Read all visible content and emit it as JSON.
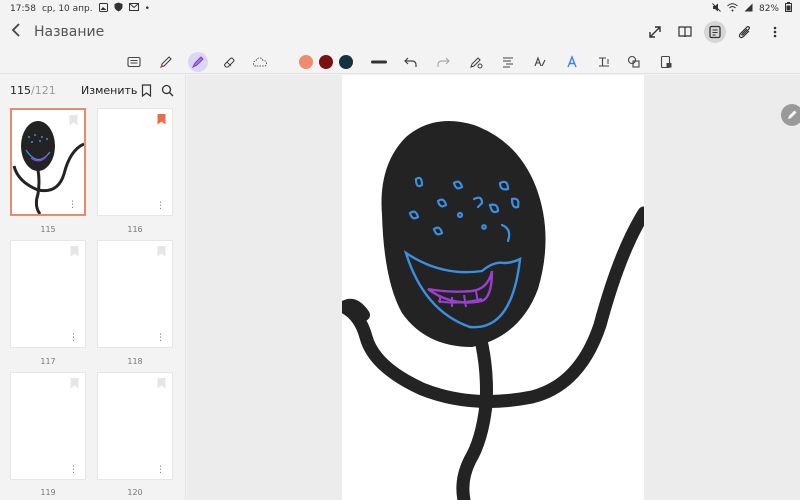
{
  "status_bar": {
    "time": "17:58",
    "date": "ср, 10 апр.",
    "battery": "82%"
  },
  "title_bar": {
    "title": "Название",
    "actions": [
      "expand-icon",
      "book-icon",
      "note-icon",
      "paperclip-icon",
      "more-icon"
    ]
  },
  "toolbar": {
    "tools": [
      "keyboard",
      "pen",
      "highlighter",
      "eraser",
      "lasso",
      "color-1",
      "color-2",
      "color-3",
      "stroke-width",
      "undo",
      "redo",
      "pen-settings",
      "text-tool",
      "handwriting-to-text",
      "ai-spell",
      "text-box",
      "shapes",
      "page-settings"
    ],
    "colors": {
      "peach": "#ef8b6f",
      "maroon": "#7b1010",
      "navy": "#143240"
    }
  },
  "sidebar": {
    "current_page": "115",
    "total_pages": "/121",
    "edit_label": "Изменить",
    "thumbnails": [
      {
        "label": "115",
        "bookmarked": false,
        "selected": true
      },
      {
        "label": "116",
        "bookmarked": true,
        "selected": false
      },
      {
        "label": "117",
        "bookmarked": false,
        "selected": false
      },
      {
        "label": "118",
        "bookmarked": false,
        "selected": false
      },
      {
        "label": "119",
        "bookmarked": false,
        "selected": false
      },
      {
        "label": "120",
        "bookmarked": false,
        "selected": false
      }
    ]
  },
  "colors": {
    "accent_orange": "#e88b6a",
    "bookmark_orange": "#f06b45",
    "ink_black": "#232323",
    "ink_blue": "#3b8fe0",
    "ink_purple": "#9b3fd0"
  }
}
